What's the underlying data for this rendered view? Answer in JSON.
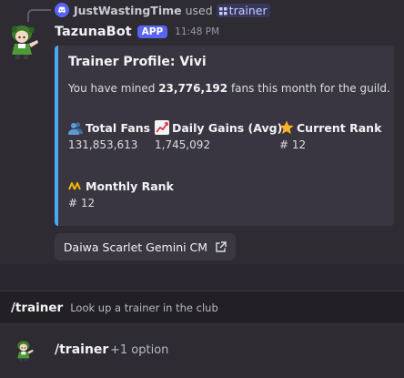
{
  "reply": {
    "user": "JustWastingTime",
    "used": "used",
    "command": "trainer",
    "icon": "discord-icon"
  },
  "message": {
    "bot_name": "TazunaBot",
    "badge": "APP",
    "time": "11:48 PM",
    "avatar_icon": "chibi-character-avatar"
  },
  "embed": {
    "accent_color": "#4aa9f0",
    "title": "Trainer Profile: Vivi",
    "desc_prefix": "You have mined ",
    "desc_fans": "23,776,192",
    "desc_suffix": " fans this month for the guild.",
    "fields": [
      {
        "name": "Total Fans",
        "value": "131,853,613",
        "icon": "busts-in-silhouette-icon"
      },
      {
        "name": "Daily Gains (Avg)",
        "value": "1,745,092",
        "icon": "chart-increasing-icon"
      },
      {
        "name": "Current Rank",
        "value": "# 12",
        "icon": "star-icon"
      },
      {
        "name": "Monthly Rank",
        "value": "# 12",
        "icon": "trending-icon"
      }
    ]
  },
  "link_button": {
    "label": "Daiwa Scarlet Gemini CM",
    "icon": "external-link-icon"
  },
  "command_hint": {
    "name": "/trainer",
    "description": "Look up a trainer in the club"
  },
  "input": {
    "command": "/trainer",
    "options": "+1 option"
  }
}
